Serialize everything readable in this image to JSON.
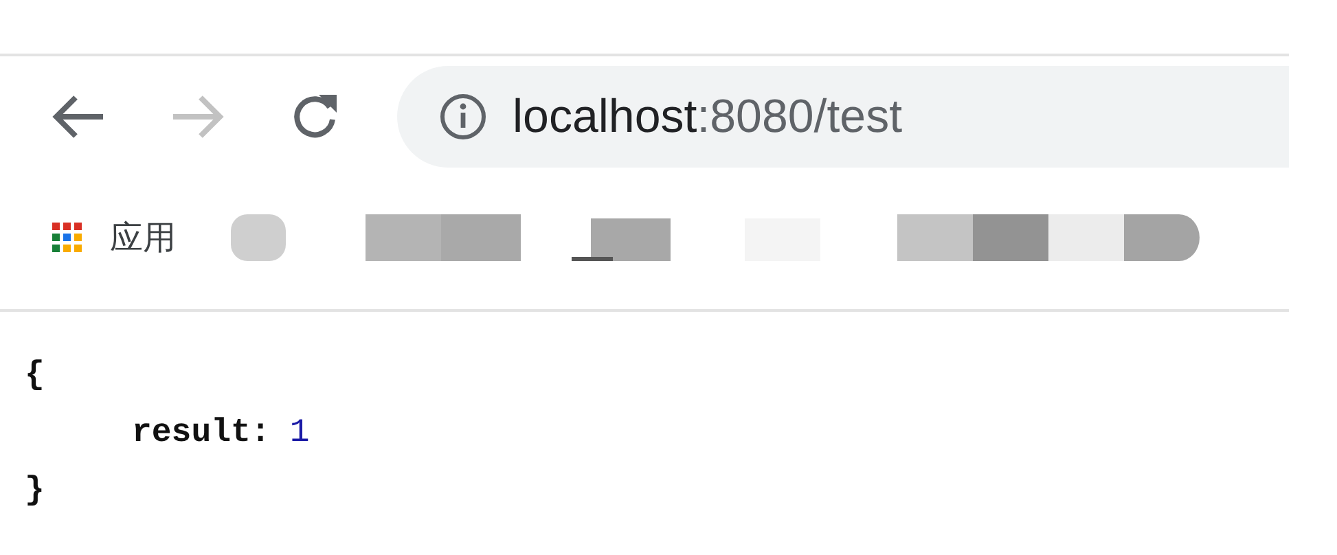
{
  "toolbar": {
    "buttons": [
      {
        "kind": "back",
        "disabled": false
      },
      {
        "kind": "forward",
        "disabled": true
      },
      {
        "kind": "reload",
        "disabled": false
      }
    ],
    "address": {
      "host": "localhost",
      "path": ":8080/test"
    }
  },
  "bookmarks_bar": {
    "apps_label": "应用"
  },
  "content": {
    "open_brace": "{",
    "entries": [
      {
        "key": "result:",
        "value": "1"
      }
    ],
    "close_brace": "}"
  }
}
